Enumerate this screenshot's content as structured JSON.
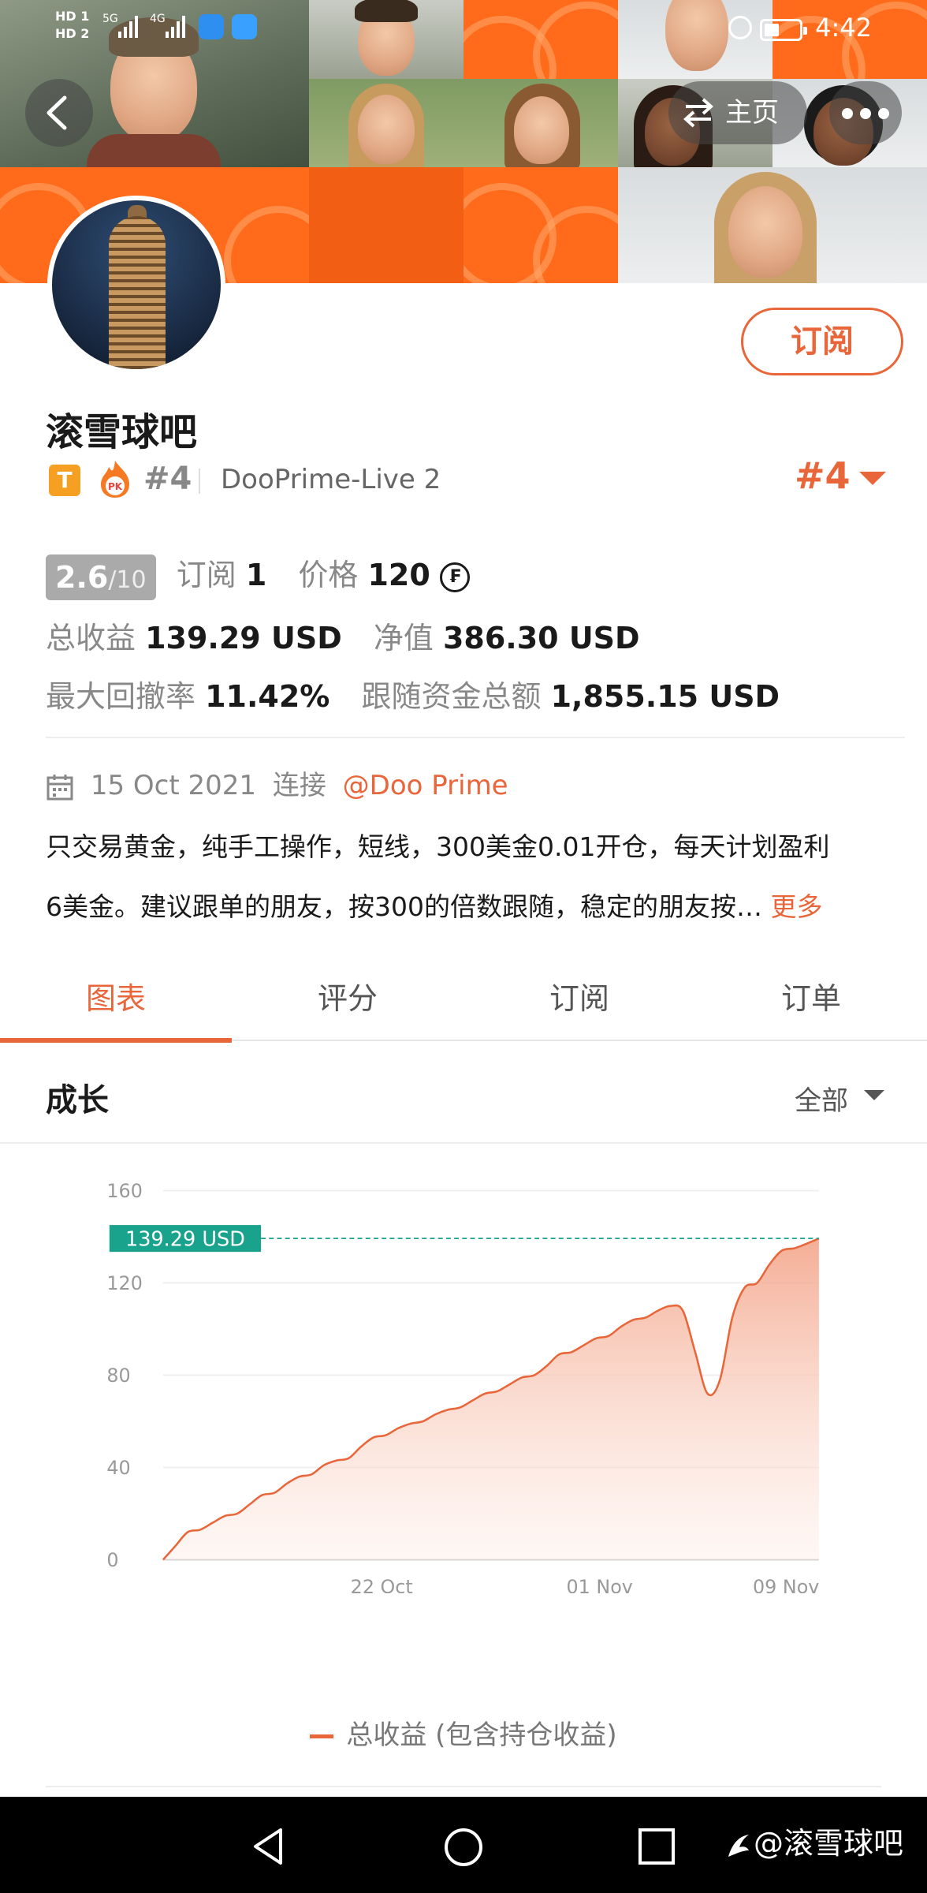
{
  "status_bar": {
    "sim1": "HD 1",
    "sim2": "HD 2",
    "net1": "5G",
    "net2": "4G",
    "time": "4:42"
  },
  "header": {
    "home_label": "主页",
    "icons": [
      "back-icon",
      "swap-icon",
      "more-icon"
    ]
  },
  "profile": {
    "name": "滚雪球吧",
    "subscribe_label": "订阅",
    "badge_letter": "T",
    "pk_label": "PK",
    "rank": "#4",
    "server": "DooPrime-Live 2",
    "rank_dropdown": "#4"
  },
  "stats": {
    "score": "2.6",
    "score_max": "/10",
    "subs_label": "订阅",
    "subs_value": "1",
    "price_label": "价格",
    "price_value": "120",
    "coin_symbol": "₣",
    "total_profit_label": "总收益",
    "total_profit_value": "139.29 USD",
    "equity_label": "净值",
    "equity_value": "386.30 USD",
    "max_dd_label": "最大回撤率",
    "max_dd_value": "11.42%",
    "follow_funds_label": "跟随资金总额",
    "follow_funds_value": "1,855.15 USD"
  },
  "joined": {
    "date": "15 Oct 2021",
    "connect_label": "连接",
    "broker": "@Doo Prime"
  },
  "description": {
    "line1": "只交易黄金，纯手工操作，短线，300美金0.01开仓，每天计划盈利",
    "line2": "6美金。建议跟单的朋友，按300的倍数跟随，稳定的朋友按…",
    "more_label": "更多"
  },
  "tabs": [
    {
      "label": "图表",
      "active": true
    },
    {
      "label": "评分",
      "active": false
    },
    {
      "label": "订阅",
      "active": false
    },
    {
      "label": "订单",
      "active": false
    }
  ],
  "growth": {
    "title": "成长",
    "range_label": "全部"
  },
  "chart_data": {
    "type": "area",
    "ylim": [
      0,
      160
    ],
    "yticks": [
      0,
      40,
      80,
      120,
      160
    ],
    "xticks": [
      "22 Oct",
      "01 Nov",
      "09 Nov"
    ],
    "current_value_label": "139.29 USD",
    "current_value": 139.29,
    "series": [
      {
        "name": "总收益 (包含持仓收益)",
        "color": "#e8663a",
        "points": [
          [
            0,
            0
          ],
          [
            1,
            6
          ],
          [
            2,
            12
          ],
          [
            3,
            13
          ],
          [
            4,
            16
          ],
          [
            5,
            19
          ],
          [
            6,
            20
          ],
          [
            7,
            24
          ],
          [
            8,
            28
          ],
          [
            9,
            29
          ],
          [
            10,
            33
          ],
          [
            11,
            36
          ],
          [
            12,
            37
          ],
          [
            13,
            41
          ],
          [
            14,
            43
          ],
          [
            15,
            44
          ],
          [
            16,
            49
          ],
          [
            17,
            53
          ],
          [
            18,
            54
          ],
          [
            19,
            57
          ],
          [
            20,
            59
          ],
          [
            21,
            60
          ],
          [
            22,
            63
          ],
          [
            23,
            65
          ],
          [
            24,
            66
          ],
          [
            25,
            69
          ],
          [
            26,
            72
          ],
          [
            27,
            73
          ],
          [
            28,
            76
          ],
          [
            29,
            79
          ],
          [
            30,
            80
          ],
          [
            31,
            84
          ],
          [
            32,
            89
          ],
          [
            33,
            90
          ],
          [
            34,
            93
          ],
          [
            35,
            96
          ],
          [
            36,
            97
          ],
          [
            37,
            101
          ],
          [
            38,
            104
          ],
          [
            39,
            105
          ],
          [
            40,
            108
          ],
          [
            41,
            110
          ],
          [
            42,
            108
          ],
          [
            43,
            90
          ],
          [
            44,
            72
          ],
          [
            45,
            78
          ],
          [
            46,
            105
          ],
          [
            47,
            118
          ],
          [
            48,
            120
          ],
          [
            49,
            128
          ],
          [
            50,
            134
          ],
          [
            51,
            135
          ],
          [
            52,
            137
          ],
          [
            53,
            139.29
          ]
        ]
      }
    ],
    "legend": "总收益 (包含持仓收益)"
  },
  "watermark": "@滚雪球吧"
}
